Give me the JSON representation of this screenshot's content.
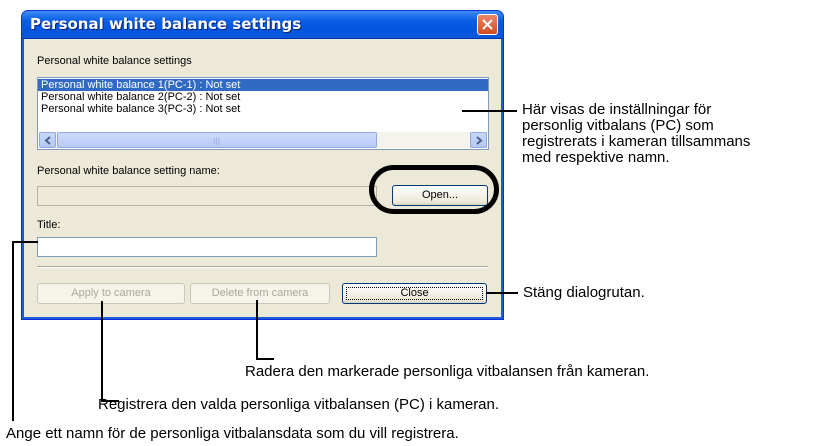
{
  "dialog": {
    "title": "Personal white balance settings",
    "group_label": "Personal white balance settings",
    "list_items": [
      "Personal white balance 1(PC-1) : Not set",
      "Personal white balance 2(PC-2) : Not set",
      "Personal white balance 3(PC-3) : Not set"
    ],
    "setting_name_label": "Personal white balance setting name:",
    "setting_name_value": "",
    "open_button": "Open...",
    "title_label": "Title:",
    "title_value": "",
    "apply_button": "Apply to camera",
    "delete_button": "Delete from camera",
    "close_button": "Close"
  },
  "callouts": {
    "list_info": [
      "Här visas de inställningar för",
      "personlig vitbalans (PC) som",
      "registrerats i kameran tillsammans",
      "med respektive namn."
    ],
    "close_info": "Stäng dialogrutan.",
    "delete_info": "Radera den markerade personliga vitbalansen från kameran.",
    "apply_info": "Registrera den valda personliga vitbalansen (PC) i kameran.",
    "title_info": "Ange ett namn för de personliga vitbalansdata som du vill registrera."
  },
  "colors": {
    "titlebar": "#0a5fe6",
    "selection": "#316ac5",
    "dialog_bg": "#ece9d8"
  }
}
